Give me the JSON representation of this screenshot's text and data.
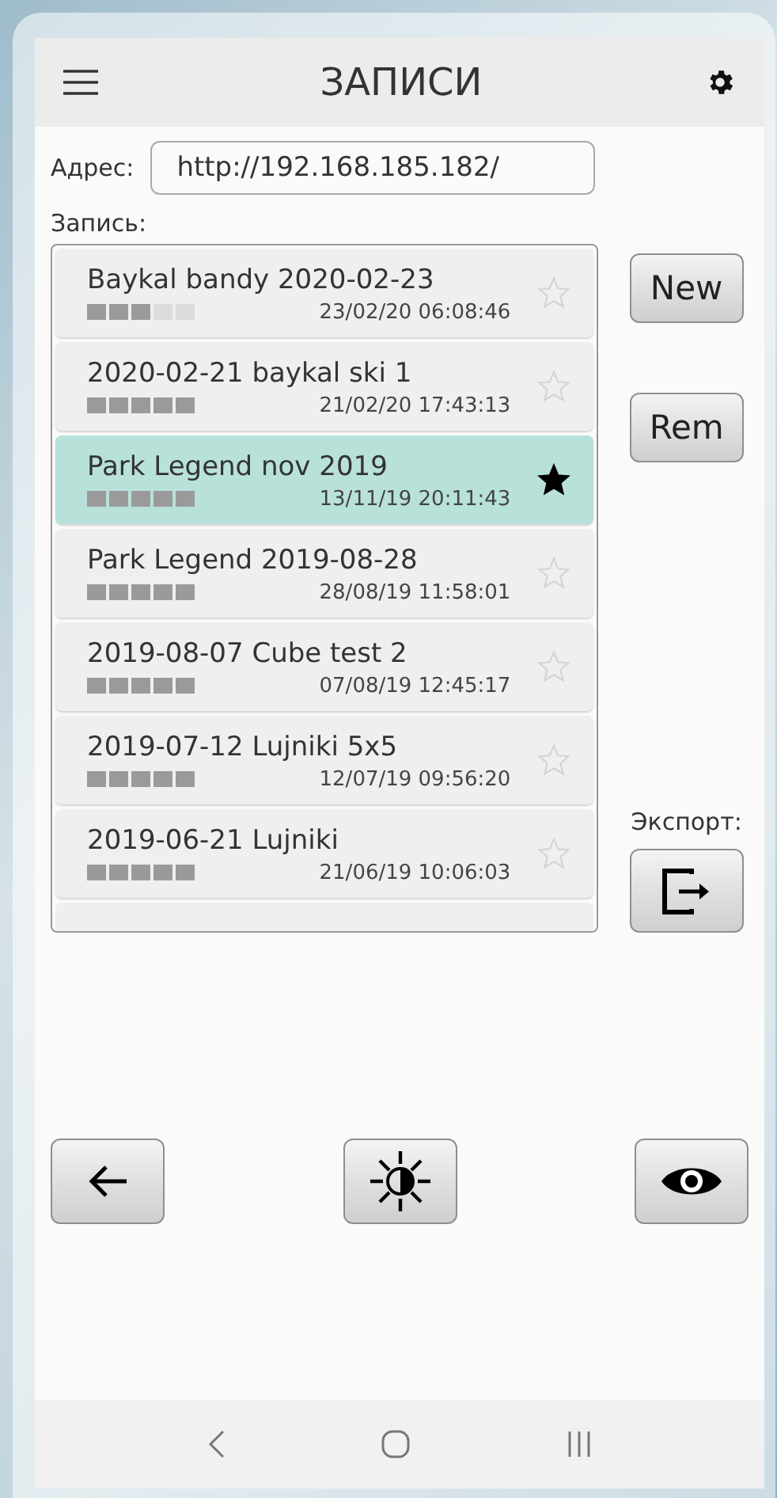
{
  "app_bar": {
    "title": "ЗАПИСИ"
  },
  "address": {
    "label": "Адрес:",
    "value": "http://192.168.185.182/"
  },
  "records_label": "Запись:",
  "records": [
    {
      "name": "Baykal bandy 2020-02-23",
      "date": "23/02/20 06:08:46",
      "level": 0.6,
      "starred": false,
      "selected": false
    },
    {
      "name": "2020-02-21 baykal ski 1",
      "date": "21/02/20 17:43:13",
      "level": 1,
      "starred": false,
      "selected": false
    },
    {
      "name": "Park Legend nov 2019",
      "date": "13/11/19 20:11:43",
      "level": 1,
      "starred": true,
      "selected": true
    },
    {
      "name": "Park Legend 2019-08-28",
      "date": "28/08/19 11:58:01",
      "level": 1,
      "starred": false,
      "selected": false
    },
    {
      "name": "2019-08-07 Cube test 2",
      "date": "07/08/19 12:45:17",
      "level": 1,
      "starred": false,
      "selected": false
    },
    {
      "name": "2019-07-12 Lujniki 5x5",
      "date": "12/07/19 09:56:20",
      "level": 1,
      "starred": false,
      "selected": false
    },
    {
      "name": "2019-06-21 Lujniki",
      "date": "21/06/19 10:06:03",
      "level": 1,
      "starred": false,
      "selected": false
    }
  ],
  "side_buttons": {
    "new": "New",
    "remove": "Rem",
    "export_label": "Экспорт:"
  }
}
